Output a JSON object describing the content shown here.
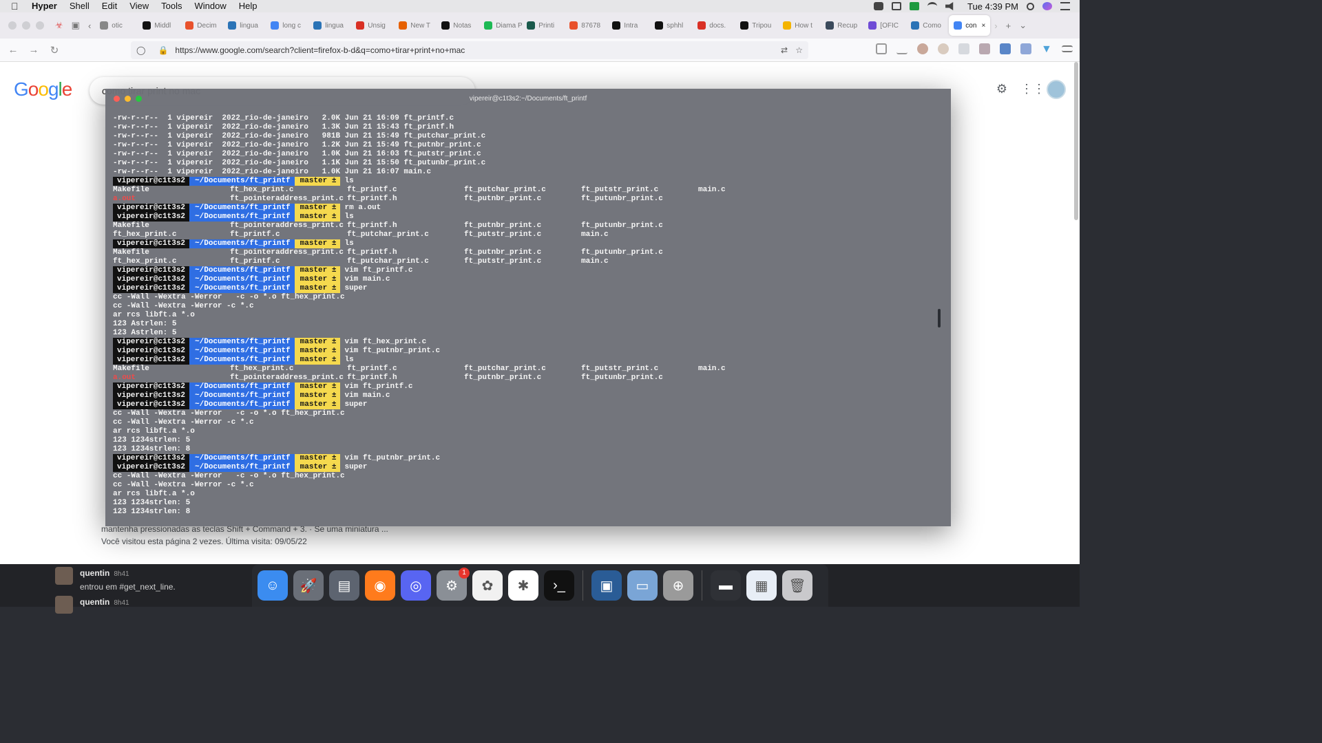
{
  "menubar": {
    "app_name": "Hyper",
    "items": [
      "Shell",
      "Edit",
      "View",
      "Tools",
      "Window",
      "Help"
    ],
    "clock": "Tue 4:39 PM"
  },
  "browser": {
    "tabs": [
      {
        "label": "otic",
        "color": "#888"
      },
      {
        "label": "Middl",
        "color": "#111"
      },
      {
        "label": "Decim",
        "color": "#e8512c"
      },
      {
        "label": "lingua",
        "color": "#2b73b6"
      },
      {
        "label": "long c",
        "color": "#4285f4"
      },
      {
        "label": "lingua",
        "color": "#2b73b6"
      },
      {
        "label": "Unsig",
        "color": "#d93025"
      },
      {
        "label": "New T",
        "color": "#e66000"
      },
      {
        "label": "Notas",
        "color": "#111"
      },
      {
        "label": "Diama PLAYING",
        "color": "#1db954"
      },
      {
        "label": "Printi",
        "color": "#1a5a4c"
      },
      {
        "label": "87678",
        "color": "#e8512c"
      },
      {
        "label": "Intra",
        "color": "#111"
      },
      {
        "label": "sphhl",
        "color": "#111"
      },
      {
        "label": "docs.",
        "color": "#d93025"
      },
      {
        "label": "Tripou",
        "color": "#111"
      },
      {
        "label": "How t",
        "color": "#f4b400"
      },
      {
        "label": "Recup",
        "color": "#3b4a5c"
      },
      {
        "label": "[OFIC",
        "color": "#6f4cd6"
      },
      {
        "label": "Como",
        "color": "#2b73b6"
      },
      {
        "label": "con",
        "color": "#4285f4"
      }
    ],
    "url": "https://www.google.com/search?client=firefox-b-d&q=como+tirar+print+no+mac"
  },
  "google": {
    "logo": "Google",
    "query": "como tirar print no mac",
    "snippet": "mantenha pressionadas as teclas Shift + Command + 3. · Se uma miniatura ...",
    "visited": "Você visitou esta página 2 vezes. Última visita: 09/05/22"
  },
  "terminal": {
    "title": "vipereir@c1t3s2:~/Documents/ft_printf",
    "prompt": {
      "user": "vipereir@c1t3s2",
      "path": "~/Documents/ft_printf",
      "branch": "master ±"
    },
    "lines": [
      {
        "t": "text",
        "text": "-rw-r--r--  1 vipereir  2022_rio-de-janeiro   2.0K Jun 21 16:09 ft_printf.c"
      },
      {
        "t": "text",
        "text": "-rw-r--r--  1 vipereir  2022_rio-de-janeiro   1.3K Jun 21 15:43 ft_printf.h"
      },
      {
        "t": "text",
        "text": "-rw-r--r--  1 vipereir  2022_rio-de-janeiro   981B Jun 21 15:49 ft_putchar_print.c"
      },
      {
        "t": "text",
        "text": "-rw-r--r--  1 vipereir  2022_rio-de-janeiro   1.2K Jun 21 15:49 ft_putnbr_print.c"
      },
      {
        "t": "text",
        "text": "-rw-r--r--  1 vipereir  2022_rio-de-janeiro   1.0K Jun 21 16:03 ft_putstr_print.c"
      },
      {
        "t": "text",
        "text": "-rw-r--r--  1 vipereir  2022_rio-de-janeiro   1.1K Jun 21 15:50 ft_putunbr_print.c"
      },
      {
        "t": "text",
        "text": "-rw-r--r--  1 vipereir  2022_rio-de-janeiro   1.0K Jun 21 16:07 main.c"
      },
      {
        "t": "prompt",
        "cmd": "ls"
      },
      {
        "t": "cols",
        "cells": [
          "Makefile",
          "ft_hex_print.c",
          "ft_printf.c",
          "ft_putchar_print.c",
          "ft_putstr_print.c",
          "main.c"
        ]
      },
      {
        "t": "cols",
        "cells": [
          "a.out",
          "ft_pointeraddress_print.c",
          "ft_printf.h",
          "ft_putnbr_print.c",
          "ft_putunbr_print.c"
        ],
        "red": [
          0
        ]
      },
      {
        "t": "prompt",
        "cmd": "rm a.out"
      },
      {
        "t": "prompt",
        "cmd": "ls"
      },
      {
        "t": "cols",
        "cells": [
          "Makefile",
          "ft_pointeraddress_print.c",
          "ft_printf.h",
          "ft_putnbr_print.c",
          "ft_putunbr_print.c"
        ]
      },
      {
        "t": "cols",
        "cells": [
          "ft_hex_print.c",
          "ft_printf.c",
          "ft_putchar_print.c",
          "ft_putstr_print.c",
          "main.c"
        ]
      },
      {
        "t": "prompt",
        "cmd": "ls"
      },
      {
        "t": "cols",
        "cells": [
          "Makefile",
          "ft_pointeraddress_print.c",
          "ft_printf.h",
          "ft_putnbr_print.c",
          "ft_putunbr_print.c"
        ]
      },
      {
        "t": "cols",
        "cells": [
          "ft_hex_print.c",
          "ft_printf.c",
          "ft_putchar_print.c",
          "ft_putstr_print.c",
          "main.c"
        ]
      },
      {
        "t": "prompt",
        "cmd": "vim ft_printf.c"
      },
      {
        "t": "prompt",
        "cmd": "vim main.c"
      },
      {
        "t": "prompt",
        "cmd": "super"
      },
      {
        "t": "text",
        "text": "cc -Wall -Wextra -Werror   -c -o *.o ft_hex_print.c"
      },
      {
        "t": "text",
        "text": "cc -Wall -Wextra -Werror -c *.c"
      },
      {
        "t": "text",
        "text": "ar rcs libft.a *.o"
      },
      {
        "t": "text",
        "text": "123 Astrlen: 5"
      },
      {
        "t": "text",
        "text": "123 Astrlen: 5"
      },
      {
        "t": "prompt",
        "cmd": "vim ft_hex_print.c"
      },
      {
        "t": "prompt",
        "cmd": "vim ft_putnbr_print.c"
      },
      {
        "t": "prompt",
        "cmd": "ls"
      },
      {
        "t": "cols",
        "cells": [
          "Makefile",
          "ft_hex_print.c",
          "ft_printf.c",
          "ft_putchar_print.c",
          "ft_putstr_print.c",
          "main.c"
        ]
      },
      {
        "t": "cols",
        "cells": [
          "a.out",
          "ft_pointeraddress_print.c",
          "ft_printf.h",
          "ft_putnbr_print.c",
          "ft_putunbr_print.c"
        ],
        "red": [
          0
        ]
      },
      {
        "t": "prompt",
        "cmd": "vim ft_printf.c"
      },
      {
        "t": "prompt",
        "cmd": "vim main.c"
      },
      {
        "t": "prompt",
        "cmd": "super"
      },
      {
        "t": "text",
        "text": "cc -Wall -Wextra -Werror   -c -o *.o ft_hex_print.c"
      },
      {
        "t": "text",
        "text": "cc -Wall -Wextra -Werror -c *.c"
      },
      {
        "t": "text",
        "text": "ar rcs libft.a *.o"
      },
      {
        "t": "text",
        "text": "123 1234strlen: 5"
      },
      {
        "t": "text",
        "text": "123 1234strlen: 8"
      },
      {
        "t": "prompt",
        "cmd": "vim ft_putnbr_print.c"
      },
      {
        "t": "prompt",
        "cmd": "super"
      },
      {
        "t": "text",
        "text": "cc -Wall -Wextra -Werror   -c -o *.o ft_hex_print.c"
      },
      {
        "t": "text",
        "text": "cc -Wall -Wextra -Werror -c *.c"
      },
      {
        "t": "text",
        "text": "ar rcs libft.a *.o"
      },
      {
        "t": "text",
        "text": "123 1234strlen: 5"
      },
      {
        "t": "text",
        "text": "123 1234strlen: 8"
      }
    ]
  },
  "slack": {
    "messages": [
      {
        "name": "quentin",
        "time": "8h41",
        "text": "entrou em #get_next_line."
      },
      {
        "name": "quentin",
        "time": "8h41",
        "text": ""
      }
    ]
  },
  "dock": {
    "badge_count": "1",
    "apps": [
      {
        "name": "finder-icon",
        "color": "#3b8cf0",
        "glyph": "☺"
      },
      {
        "name": "launchpad-icon",
        "color": "#6a6f78",
        "glyph": "🚀"
      },
      {
        "name": "archive-icon",
        "color": "#5d6470",
        "glyph": "▤"
      },
      {
        "name": "firefox-icon",
        "color": "#ff7b1c",
        "glyph": "◉"
      },
      {
        "name": "discord-icon",
        "color": "#5865f2",
        "glyph": "◎"
      },
      {
        "name": "system-preferences-icon",
        "color": "#8a8f96",
        "glyph": "⚙"
      },
      {
        "name": "photos-icon",
        "color": "#f1f1f1",
        "glyph": "✿"
      },
      {
        "name": "slack-icon",
        "color": "#ffffff",
        "glyph": "✱"
      },
      {
        "name": "hyper-terminal-icon",
        "color": "#111111",
        "glyph": "›_"
      },
      {
        "name": "virtualbox-icon",
        "color": "#2a5c96",
        "glyph": "▣"
      },
      {
        "name": "preview-icon",
        "color": "#7aa5d6",
        "glyph": "▭"
      },
      {
        "name": "disk-utility-icon",
        "color": "#9a9a9a",
        "glyph": "⊕"
      },
      {
        "name": "window-thumb-icon",
        "color": "#2f3136",
        "glyph": "▬"
      },
      {
        "name": "document-thumb-icon",
        "color": "#e8eef6",
        "glyph": "▦"
      },
      {
        "name": "trash-icon",
        "color": "#c9c9cc",
        "glyph": "🗑"
      }
    ]
  }
}
